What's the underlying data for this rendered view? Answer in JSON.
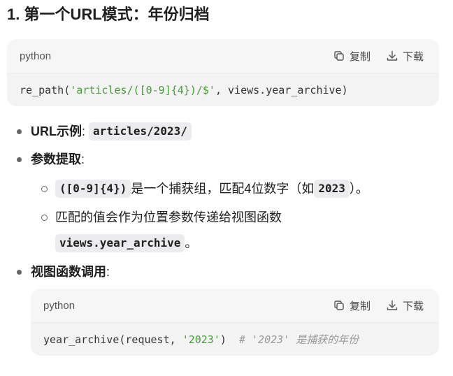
{
  "heading": "1. 第一个URL模式：年份归档",
  "code_blocks": [
    {
      "language": "python",
      "copy_label": "复制",
      "download_label": "下载",
      "code": {
        "func": "re_path(",
        "string": "'articles/([0-9]{4})/$'",
        "rest": ", views.year_archive)"
      }
    },
    {
      "language": "python",
      "copy_label": "复制",
      "download_label": "下载",
      "code": {
        "func": "year_archive(request, ",
        "string": "'2023'",
        "rest": ")  ",
        "comment": "# '2023' 是捕获的年份"
      }
    }
  ],
  "bullets": {
    "url_example": {
      "label": "URL示例",
      "colon": ":",
      "code": "articles/2023/"
    },
    "param_extract": {
      "label": "参数提取",
      "colon": ":",
      "sub1": {
        "code": "([0-9]{4})",
        "text_a": " 是一个捕获组，匹配4位数字（如",
        "code2": "2023",
        "text_b": "）。"
      },
      "sub2": {
        "text": "匹配的值会作为位置参数传递给视图函数",
        "code": "views.year_archive",
        "tail": "。"
      }
    },
    "view_call": {
      "label": "视图函数调用",
      "colon": ":"
    }
  }
}
